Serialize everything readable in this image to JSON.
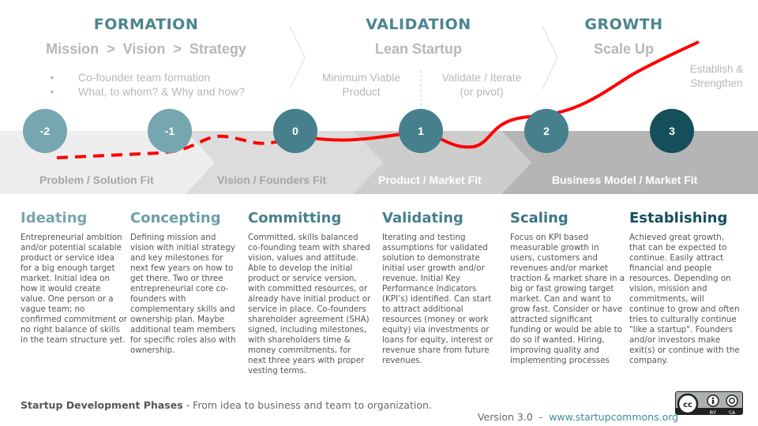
{
  "phases": [
    {
      "title": "FORMATION",
      "subtitle": "Mission  >  Vision  >  Strategy",
      "bullets": [
        "Co-founder team formation",
        "What, to whom? & Why and how?"
      ]
    },
    {
      "title": "VALIDATION",
      "subtitle": "Lean Startup",
      "notes": [
        "Minimum Viable\nProduct",
        "Validate / Iterate\n(or pivot)"
      ]
    },
    {
      "title": "GROWTH",
      "subtitle": "Scale Up",
      "notes": [
        "Establish &\nStrengthen"
      ]
    }
  ],
  "bullet_glyph": "●",
  "milestones": [
    {
      "label": "-2",
      "color": "#76a6b0"
    },
    {
      "label": "-1",
      "color": "#76a6b0"
    },
    {
      "label": "0",
      "color": "#46808d"
    },
    {
      "label": "1",
      "color": "#46808d"
    },
    {
      "label": "2",
      "color": "#46808d"
    },
    {
      "label": "3",
      "color": "#154f5c"
    }
  ],
  "fits": [
    {
      "label": "Problem / Solution Fit",
      "color": "#eeeeee",
      "text_color": "#a6a6a6"
    },
    {
      "label": "Vision / Founders Fit",
      "color": "#dcdcdc",
      "text_color": "#a6a6a6"
    },
    {
      "label": "Product / Market Fit",
      "color": "#cdcdcd",
      "text_color": "#ffffff"
    },
    {
      "label": "Business Model / Market Fit",
      "color": "#b5b5b5",
      "text_color": "#ffffff"
    }
  ],
  "growth_curve_color": "#ff0000",
  "stages": [
    {
      "title": "Ideating",
      "color": "#76a6b0",
      "text": "Entrepreneurial ambition and/or potential scalable product or service idea for a big enough target market. Initial idea on how it would create value. One person or a vague team; no confirmed commitment or no right balance of skills in the team structure yet."
    },
    {
      "title": "Concepting",
      "color": "#6a9ea8",
      "text": "Defining mission and vision with initial strategy and key milestones for next few years on how to get there. Two or three entrepreneurial core co-founders with complementary skills and ownership plan. Maybe additional team members for specific roles also with ownership."
    },
    {
      "title": "Committing",
      "color": "#46808d",
      "text": "Committed, skills balanced co-founding team with shared vision, values and attitude. Able to develop the initial product or service version, with committed resources, or already have initial product or service in place. Co-founders shareholder agreement (SHA) signed, including milestones, with shareholders time & money commitments, for next three years with proper vesting terms."
    },
    {
      "title": "Validating",
      "color": "#46808d",
      "text": "Iterating and testing assumptions for validated solution to demonstrate initial user growth and/or revenue. Initial Key Performance Indicators (KPI’s) identified. Can start to attract additional resources (money or work equity) via investments or loans for equity, interest or revenue share from future revenues."
    },
    {
      "title": "Scaling",
      "color": "#3a7785",
      "text": "Focus on KPI based measurable growth in users, customers and revenues and/or market traction & market share in a big or fast growing target market. Can and want to grow fast. Consider or have attracted significant funding or would be able to do so if wanted. Hiring, improving quality and implementing processes"
    },
    {
      "title": "Establishing",
      "color": "#154f5c",
      "text": "Achieved great growth, that can be expected to continue. Easily attract financial and people resources. Depending on vision, mission and commitments, will continue to grow and often tries to culturally continue \"like a startup\". Founders and/or investors make exit(s) or continue with the company."
    }
  ],
  "footer": {
    "title": "Startup Development Phases",
    "tagline": " - From idea to business and team to organization.",
    "version": "Version 3.0  -  ",
    "url": "www.startupcommons.org",
    "license": {
      "cc": "cc",
      "by": "BY",
      "sa": "SA"
    }
  }
}
